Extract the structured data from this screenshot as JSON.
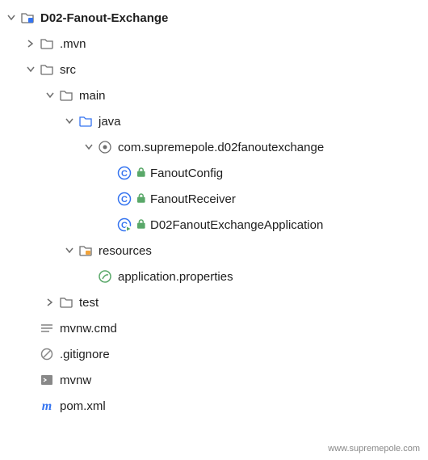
{
  "watermark": "www.supremepole.com",
  "tree": {
    "root": {
      "label": "D02-Fanout-Exchange",
      "expanded": true,
      "children": {
        "mvn": {
          "label": ".mvn",
          "expanded": false
        },
        "src": {
          "label": "src",
          "expanded": true,
          "children": {
            "main": {
              "label": "main",
              "expanded": true,
              "children": {
                "java": {
                  "label": "java",
                  "expanded": true,
                  "children": {
                    "pkg": {
                      "label": "com.supremepole.d02fanoutexchange",
                      "expanded": true,
                      "children": {
                        "c0": {
                          "label": "FanoutConfig"
                        },
                        "c1": {
                          "label": "FanoutReceiver"
                        },
                        "c2": {
                          "label": "D02FanoutExchangeApplication"
                        }
                      }
                    }
                  }
                },
                "resources": {
                  "label": "resources",
                  "expanded": true,
                  "children": {
                    "props": {
                      "label": "application.properties"
                    }
                  }
                }
              }
            },
            "test": {
              "label": "test",
              "expanded": false
            }
          }
        },
        "mvnwcmd": {
          "label": "mvnw.cmd"
        },
        "gitignore": {
          "label": ".gitignore"
        },
        "mvnw": {
          "label": "mvnw"
        },
        "pom": {
          "label": "pom.xml"
        }
      }
    }
  }
}
